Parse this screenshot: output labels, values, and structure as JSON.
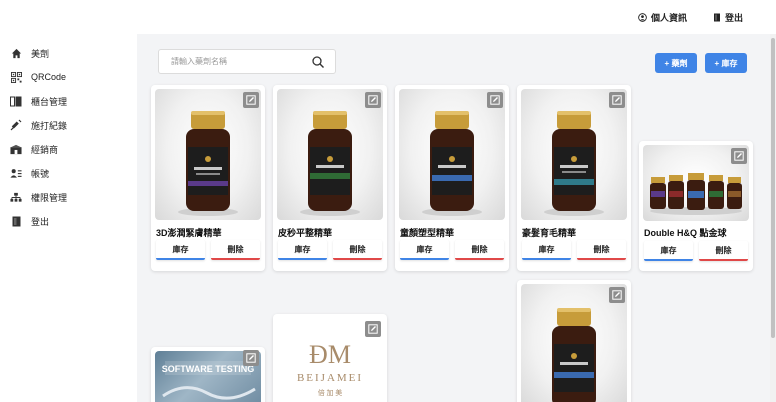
{
  "topbar": {
    "profile_label": "個人資訊",
    "logout_label": "登出"
  },
  "sidebar": {
    "items": [
      {
        "label": "美劑",
        "icon": "home-icon"
      },
      {
        "label": "QRCode",
        "icon": "qrcode-icon"
      },
      {
        "label": "櫃台管理",
        "icon": "counter-icon"
      },
      {
        "label": "施打紀錄",
        "icon": "syringe-icon"
      },
      {
        "label": "經銷商",
        "icon": "dealer-icon"
      },
      {
        "label": "帳號",
        "icon": "users-icon"
      },
      {
        "label": "權限管理",
        "icon": "sitemap-icon"
      },
      {
        "label": "登出",
        "icon": "logout-icon"
      }
    ]
  },
  "search": {
    "placeholder": "請輸入藥劑名稱",
    "value": ""
  },
  "toolbar": {
    "add_drug_label": "+ 藥劑",
    "add_stock_label": "+ 庫存"
  },
  "card_actions": {
    "stock_label": "庫存",
    "delete_label": "刪除"
  },
  "products": [
    {
      "name": "3D澎潤緊膚精華",
      "band_color": "#5a3a8a"
    },
    {
      "name": "皮秒平整精華",
      "band_color": "#2f6b35"
    },
    {
      "name": "童顏塑型精華",
      "band_color": "#3a6ab0"
    },
    {
      "name": "豪髮育毛精華",
      "band_color": "#2f7a8a"
    },
    {
      "name": "Double H&Q 點金球",
      "band_color": "#8a5a2a"
    }
  ],
  "bottom_cards": [
    {
      "image_text": "SOFTWARE TESTING"
    },
    {
      "logo_text": "BEIJAMEI",
      "logo_sub": "倍 加 美"
    },
    {
      "band_color": "#3a6ab0"
    }
  ],
  "colors": {
    "accent": "#3f84e6",
    "danger": "#e04848",
    "background": "#f3f4f6"
  }
}
